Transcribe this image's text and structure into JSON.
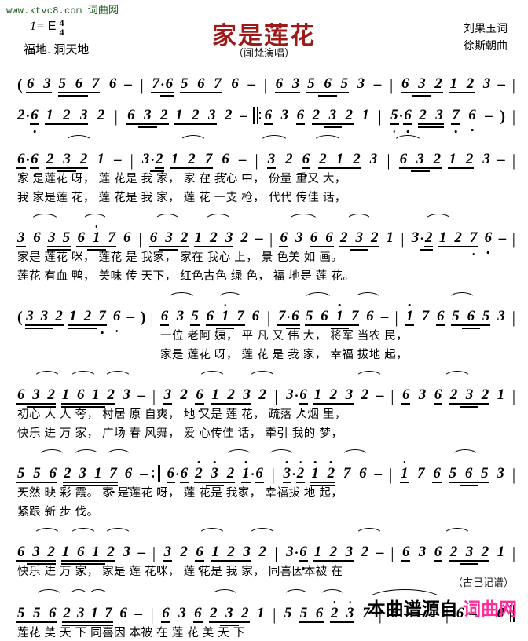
{
  "watermark": {
    "url": "www.ktvc8.com",
    "site_cn": "词曲网"
  },
  "header": {
    "key_label": "1=",
    "key_value": "E",
    "time_numerator": "4",
    "time_denominator": "4",
    "subtitle_left": "福地. 洞天地",
    "title": "家是莲花",
    "subtitle_center": "（闻梵演唱）",
    "lyricist": "刘果玉词",
    "composer": "徐斯朝曲"
  },
  "footer": {
    "notation_credit": "（古己记谱）",
    "source_prefix": "本曲谱源自",
    "source_site": "词曲网"
  },
  "score": {
    "notation_type": "jianpu",
    "systems": [
      {
        "id": "system-1",
        "notes": "( 6 3 5 6 7 6 -  |  7· 6 5 6 7 6 -  |  6 3 5 6 5 3 -  |  6 3 2 1 2 3 - |",
        "lyrics_lines": []
      },
      {
        "id": "system-2",
        "notes": "2· 6 1 2 3 2 | 6 3 2 1 2 3 2 - ‖: 6 3 6 2 3 2 1 | 5· 6 2 3 7 6 - ) |",
        "lyrics_lines": []
      },
      {
        "id": "system-3",
        "notes": "6· 6 2 3 2 1 - | 3· 2 1 2 7 6 - | 3 2 6 2 1 2 3 | 6 3 2 1 2 3 - |",
        "lyrics_lines": [
          "家 是莲花  呀，   莲 花是  我 家，    家 在   我心   中，  份量  重又 大，",
          "我 家是莲  花，   莲 花是  我 家，    莲 花   一支   枪，  代代  传佳 话，"
        ]
      },
      {
        "id": "system-4",
        "notes": "3 6 3 5 6 1̇ 7 6 | 6 3 2 1 2 3 2 - | 6 3 6 6 2 3 2 1 | 3· 2 1 2 7 6 - |",
        "lyrics_lines": [
          "家是   莲花  咪， 莲花  是  我家，   家在    我心  上， 景 色美  如 画。",
          "莲花   有血  鸭， 美味  传  天下，   红色古色 绿   色， 福 地是  莲 花。"
        ]
      },
      {
        "id": "system-5",
        "notes": "( 3 3 2 1 2 7 6 - ) | 6 3 5 6 1̇ 7 6 | 7· 6 5 6 1̇ 7 6 - | 1̇ 7 6 5 6 5 3 |",
        "lyrics_lines": [
          "一位  老阿  姨， 平 凡 又  伟 大，   将军   当农  民，",
          "家是  莲花  呀， 莲 花 是  我 家，   幸福   拔地  起，"
        ]
      },
      {
        "id": "system-6",
        "notes": "6 3 2 1 6 1 2 3 - | 3 2 6 1 2 3 2 | 3· 6 1 2 3 2 - | 6 3 6 2 3 2 1 |",
        "lyrics_lines": [
          "初心  人  人  夸，  村居  原  自爽， 地 又是  莲 花，   疏落  人烟   里，",
          "快乐  进  万  家，  广场  春  风舞， 爱 心传佳  话，   牵引  我的   梦，"
        ]
      },
      {
        "id": "system-7",
        "notes": "5 5 6 2 3 1 7 6 - :‖ 6· 6 2̇ 3̇ 2 1̇ · 6 | 3̇· 2̇ 1̇ 2̇ 7 6 - | 1̇ 7 6 5 6 5 3 |",
        "lyrics_lines": [
          "天然  映 彩  霞。  家 是莲花  呀，   莲 花是  我家，   幸福拔 地   起，",
          "紧跟  新 步  伐。"
        ]
      },
      {
        "id": "system-8",
        "notes": "6 3 2 1 6 1 2 3 - | 3 2 6 1 2 3 2 | 3· 6 1 2 3 2 - | 6 3 6 2 3 2 1 |",
        "lyrics_lines": [
          "快乐  进 万  家，   家是  莲  花咪， 莲 花是  我 家，   同喜因本被   在"
        ]
      },
      {
        "id": "system-9",
        "notes": "5 5 6 2 3 1 7 6 - | 6 3 6 2 3 2 1 | 5 5 6 2̇ 3̇ 7 | 6 - - - | 6 - - 0 ‖",
        "lyrics_lines": [
          "莲花  美 天 下   同喜因 本被  在 莲 花 美 天 下"
        ]
      }
    ]
  }
}
